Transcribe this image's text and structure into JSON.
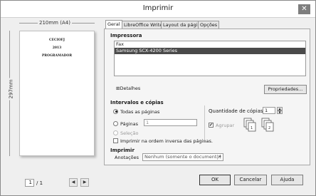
{
  "window": {
    "title": "Imprimir",
    "close_glyph": "✕"
  },
  "preview": {
    "width_label": "210mm (A4)",
    "height_label": "297mm",
    "page_lines": [
      "CECIOFJ",
      "2013",
      "PROGRAMADOR"
    ],
    "current_page": "1",
    "page_total": "/ 1",
    "prev_glyph": "◀",
    "next_glyph": "▶"
  },
  "tabs": [
    {
      "label": "Geral",
      "active": true
    },
    {
      "label": "LibreOffice Writer",
      "active": false
    },
    {
      "label": "Layout da página",
      "active": false
    },
    {
      "label": "Opções",
      "active": false
    }
  ],
  "printer": {
    "section_label": "Impressora",
    "items": [
      {
        "label": "Fax",
        "selected": false
      },
      {
        "label": "Samsung SCX-4200 Series",
        "selected": true
      }
    ],
    "details_label": "Detalhes",
    "details_glyph": "⊞",
    "properties_label": "Propriedades..."
  },
  "range": {
    "section_label": "Intervalos e cópias",
    "all_pages_label": "Todas as páginas",
    "pages_label": "Páginas",
    "pages_value": "1",
    "selection_label": "Seleção",
    "reverse_label": "Imprimir na ordem inversa das páginas.",
    "copies_label": "Quantidade de cópias",
    "copies_value": "1",
    "collate_label": "Agrupar",
    "collate_checked": true
  },
  "print_section": {
    "section_label": "Imprimir",
    "annotations_label": "Anotações",
    "annotations_value": "Nenhum (somente o documento)"
  },
  "buttons": {
    "ok": "OK",
    "cancel": "Cancelar",
    "help": "Ajuda"
  }
}
